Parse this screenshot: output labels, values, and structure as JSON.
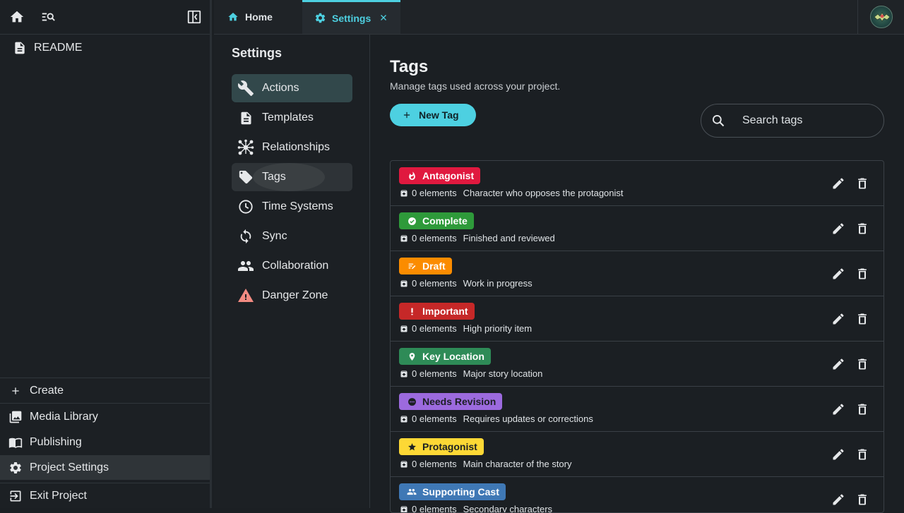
{
  "sidebar": {
    "readme": "README",
    "create": "Create",
    "media_library": "Media Library",
    "publishing": "Publishing",
    "project_settings": "Project Settings",
    "exit_project": "Exit Project"
  },
  "tabs": {
    "home": "Home",
    "settings": "Settings"
  },
  "settings_nav": {
    "title": "Settings",
    "items": [
      "Actions",
      "Templates",
      "Relationships",
      "Tags",
      "Time Systems",
      "Sync",
      "Collaboration",
      "Danger Zone"
    ],
    "active": "Tags"
  },
  "main": {
    "title": "Tags",
    "subtitle": "Manage tags used across your project.",
    "new_tag_label": "New Tag",
    "search_placeholder": "Search tags"
  },
  "tags": [
    {
      "name": "Antagonist",
      "count": "0 elements",
      "description": "Character who opposes the protagonist",
      "color": "#e0193f",
      "text_color": "#ffffff",
      "icon": "flame-icon"
    },
    {
      "name": "Complete",
      "count": "0 elements",
      "description": "Finished and reviewed",
      "color": "#2e9a3a",
      "text_color": "#ffffff",
      "icon": "check-circle-icon"
    },
    {
      "name": "Draft",
      "count": "0 elements",
      "description": "Work in progress",
      "color": "#fb8c00",
      "text_color": "#ffffff",
      "icon": "draft-icon"
    },
    {
      "name": "Important",
      "count": "0 elements",
      "description": "High priority item",
      "color": "#c62828",
      "text_color": "#ffffff",
      "icon": "exclamation-icon"
    },
    {
      "name": "Key Location",
      "count": "0 elements",
      "description": "Major story location",
      "color": "#2e8b57",
      "text_color": "#ffffff",
      "icon": "location-pin-icon"
    },
    {
      "name": "Needs Revision",
      "count": "0 elements",
      "description": "Requires updates or corrections",
      "color": "#9c6ade",
      "text_color": "#1b1f23",
      "icon": "more-horiz-circle-icon"
    },
    {
      "name": "Protagonist",
      "count": "0 elements",
      "description": "Main character of the story",
      "color": "#fdd835",
      "text_color": "#1b1f23",
      "icon": "star-icon"
    },
    {
      "name": "Supporting Cast",
      "count": "0 elements",
      "description": "Secondary characters",
      "color": "#3f78b5",
      "text_color": "#ffffff",
      "icon": "people-icon"
    }
  ],
  "colors": {
    "accent": "#4dd0e1"
  }
}
